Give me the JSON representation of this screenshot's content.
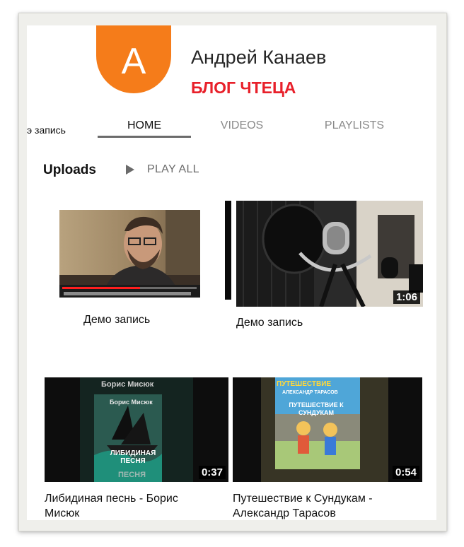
{
  "channel": {
    "avatar_letter": "A",
    "name": "Андрей Канаев",
    "subtitle": "БЛОГ ЧТЕЦА",
    "avatar_color": "#f57c1a",
    "subtitle_color": "#e8202a"
  },
  "clipped_text": "э запись",
  "tabs": [
    {
      "label": "HOME",
      "active": true
    },
    {
      "label": "VIDEOS",
      "active": false
    },
    {
      "label": "PLAYLISTS",
      "active": false
    }
  ],
  "uploads": {
    "label": "Uploads",
    "play_all_label": "PLAY ALL",
    "play_icon": "play-triangle-icon"
  },
  "videos": [
    {
      "title": "Демо запись",
      "duration": ""
    },
    {
      "title": "Демо запись",
      "duration": "1:06"
    },
    {
      "title_line1": "Либидиная песнь - Борис",
      "title_line2": "Мисюк",
      "duration": "0:37",
      "cover_author": "Борис Мисюк",
      "cover_author2": "Борис Мисюк",
      "cover_title": "ЛИБИДИНАЯ ПЕСНЯ",
      "cover_bottom": "ПЕСНЯ"
    },
    {
      "title_line1": "Путешествие к Сундукам -",
      "title_line2": "Александр Тарасов",
      "duration": "0:54",
      "cover_top": "ПУТЕШЕСТВИЕ",
      "cover_author": "АЛЕКСАНДР ТАРАСОВ",
      "cover_title": "ПУТЕШЕСТВИЕ К СУНДУКАМ"
    }
  ]
}
